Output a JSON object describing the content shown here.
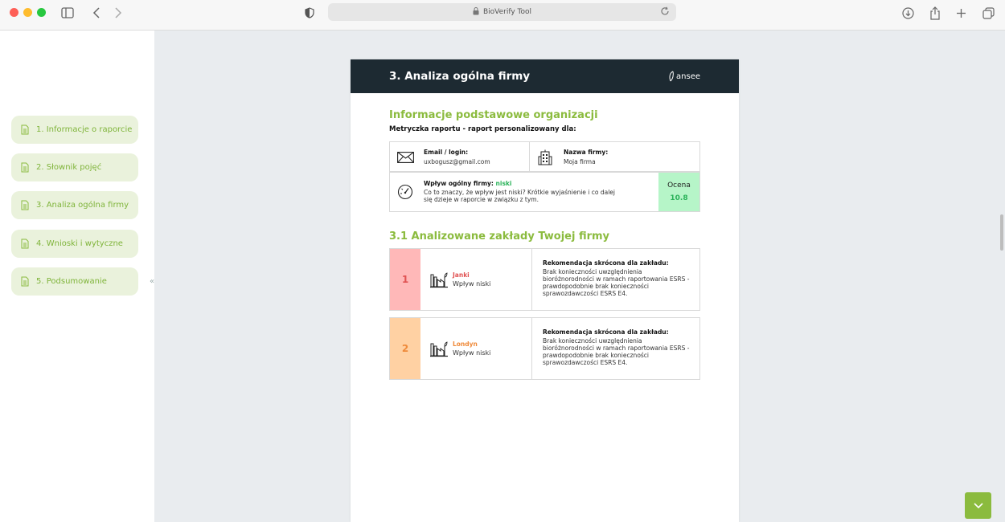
{
  "browser": {
    "url": "BioVerify Tool"
  },
  "sidebar": {
    "items": [
      {
        "label": "1. Informacje o raporcie"
      },
      {
        "label": "2. Słownik pojęć"
      },
      {
        "label": "3. Analiza ogólna firmy"
      },
      {
        "label": "4. Wnioski i wytyczne"
      },
      {
        "label": "5. Podsumowanie"
      }
    ],
    "collapse_glyph": "«"
  },
  "doc": {
    "title": "3. Analiza ogólna firmy",
    "logo_text": "ansee",
    "section1_title": "Informacje podstawowe organizacji",
    "metric_line": "Metryczka raportu - raport personalizowany dla:",
    "email_label": "Email / login:",
    "email_value": "uxbogusz@gmail.com",
    "company_label": "Nazwa firmy:",
    "company_value": "Moja firma",
    "impact_label": "Wpływ ogólny firmy:",
    "impact_value": "niski",
    "impact_desc": "Co to znaczy, że wpływ jest niski? Krótkie wyjaśnienie i co dalej się dzieje w raporcie w związku z tym.",
    "score_label": "Ocena",
    "score_value": "10.8",
    "section2_title": "3.1 Analizowane zakłady Twojej firmy",
    "plants": [
      {
        "num": "1",
        "name": "Janki",
        "impact": "Wpływ niski",
        "rec_title": "Rekomendacja skrócona dla zakładu:",
        "rec_text": "Brak konieczności uwzględnienia bioróżnorodności w ramach raportowania ESRS - prawdopodobnie brak konieczności sprawozdawczości ESRS E4."
      },
      {
        "num": "2",
        "name": "Londyn",
        "impact": "Wpływ niski",
        "rec_title": "Rekomendacja skrócona dla zakładu:",
        "rec_text": "Brak konieczności uwzględnienia bioróżnorodności w ramach raportowania ESRS - prawdopodobnie brak konieczności sprawozdawczości ESRS E4."
      }
    ]
  },
  "colors": {
    "accent_green": "#8bbb3e",
    "header_dark": "#1d2a32",
    "plant1_bg": "#ffb8b8",
    "plant1_fg": "#e05252",
    "plant2_bg": "#ffd1a3",
    "plant2_fg": "#ef8a3a",
    "score_bg": "#b6f5c8",
    "score_fg": "#2bb35a"
  }
}
